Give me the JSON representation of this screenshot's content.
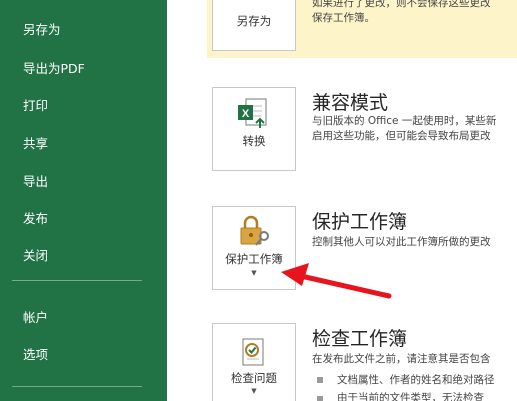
{
  "sidebar": {
    "items": [
      {
        "label": "另存为"
      },
      {
        "label": "导出为PDF"
      },
      {
        "label": "打印"
      },
      {
        "label": "共享"
      },
      {
        "label": "导出"
      },
      {
        "label": "发布"
      },
      {
        "label": "关闭"
      },
      {
        "label": "帐户"
      },
      {
        "label": "选项"
      }
    ]
  },
  "sections": {
    "save_as": {
      "tile_label": "另存为",
      "desc": [
        "如果进行了更改，则不会保存这些更改",
        "保存工作簿。"
      ]
    },
    "compat": {
      "title": "兼容模式",
      "tile_label": "转换",
      "desc": [
        "与旧版本的 Office 一起使用时，某些新",
        "启用这些功能，但可能会导致布局更改"
      ]
    },
    "protect": {
      "title": "保护工作簿",
      "tile_label": "保护工作簿",
      "desc": [
        "控制其他人可以对此工作簿所做的更改"
      ]
    },
    "inspect": {
      "title": "检查工作簿",
      "tile_label": "检查问题",
      "desc": [
        "在发布此文件之前，请注意其是否包含"
      ],
      "bullets": [
        "文档属性、作者的姓名和绝对路径",
        "由于当前的文件类型，无法检查"
      ]
    }
  },
  "colors": {
    "sidebar_bg": "#217346",
    "warning_bg": "#fdf5c9",
    "arrow": "#e8141d",
    "excel_green": "#217346",
    "lock_gold": "#d9a441"
  }
}
